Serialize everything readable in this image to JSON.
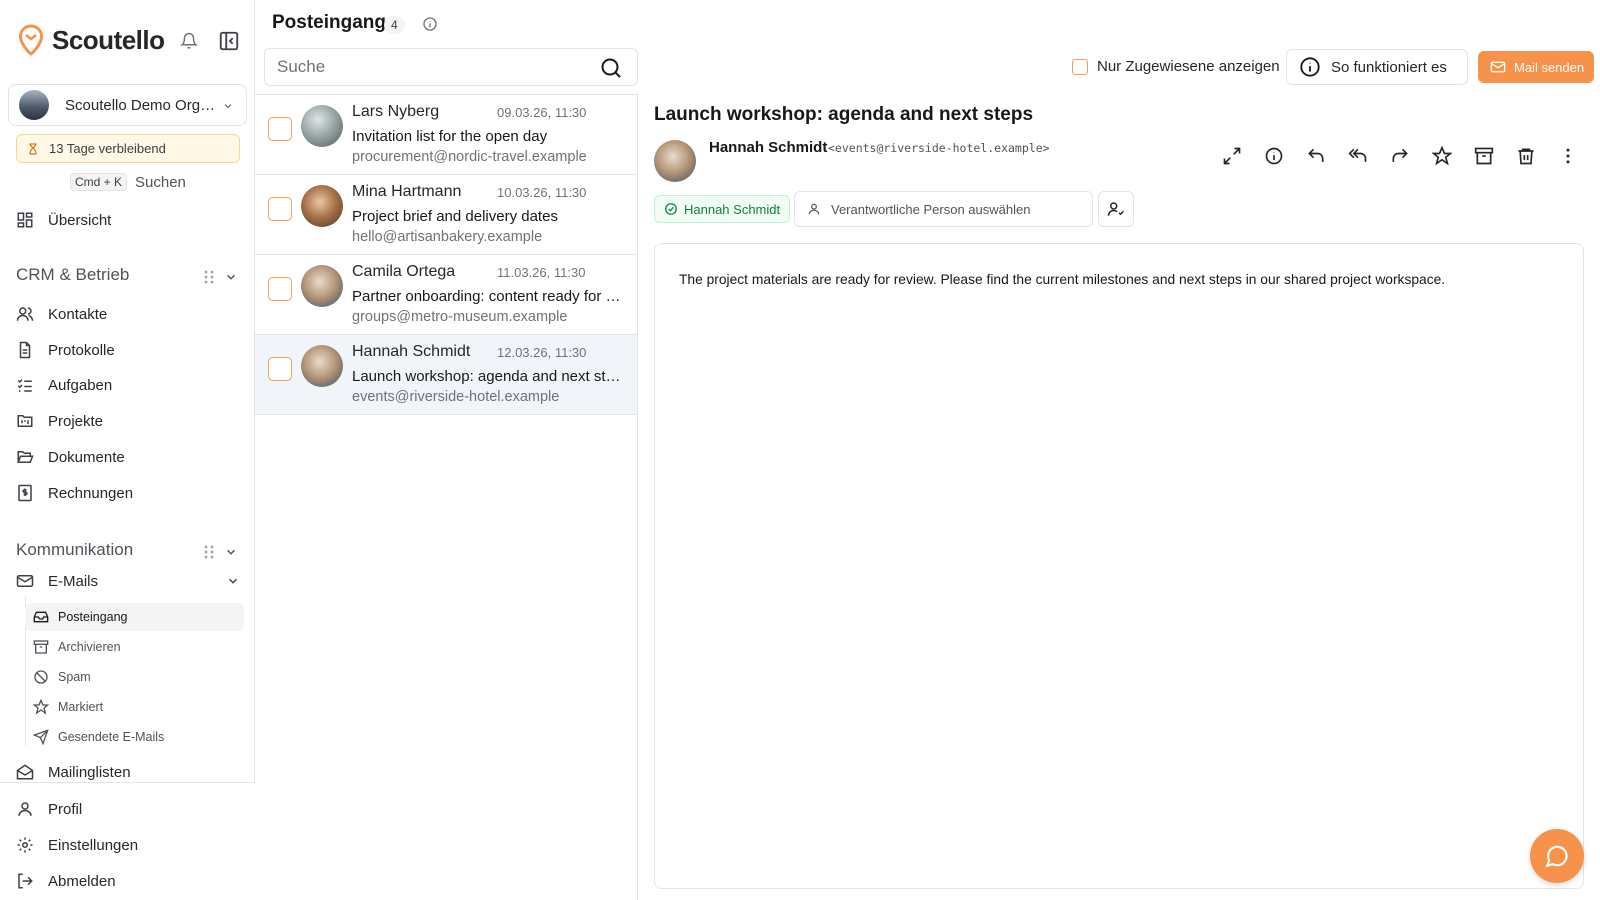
{
  "brand": {
    "name": "Scoutello"
  },
  "org": {
    "name": "Scoutello Demo Organisation"
  },
  "trial": {
    "text": "13 Tage verbleibend"
  },
  "search_shortcut": {
    "keys": "Cmd + K",
    "label": "Suchen"
  },
  "nav": {
    "overview": "Übersicht",
    "section_crm": "CRM & Betrieb",
    "crm_items": [
      "Kontakte",
      "Protokolle",
      "Aufgaben",
      "Projekte",
      "Dokumente",
      "Rechnungen"
    ],
    "section_comm": "Kommunikation",
    "emails": "E-Mails",
    "email_sub": [
      "Posteingang",
      "Archivieren",
      "Spam",
      "Markiert",
      "Gesendete E-Mails"
    ],
    "mailinglists": "Mailinglisten",
    "bottom": [
      "Profil",
      "Einstellungen",
      "Abmelden"
    ]
  },
  "inbox": {
    "title": "Posteingang",
    "count": "4",
    "search_placeholder": "Suche",
    "messages": [
      {
        "from": "Lars Nyberg",
        "date": "09.03.26, 11:30",
        "subject": "Invitation list for the open day",
        "address": "procurement@nordic-travel.example"
      },
      {
        "from": "Mina Hartmann",
        "date": "10.03.26, 11:30",
        "subject": "Project brief and delivery dates",
        "address": "hello@artisanbakery.example"
      },
      {
        "from": "Camila Ortega",
        "date": "11.03.26, 11:30",
        "subject": "Partner onboarding: content ready for review",
        "address": "groups@metro-museum.example"
      },
      {
        "from": "Hannah Schmidt",
        "date": "12.03.26, 11:30",
        "subject": "Launch workshop: agenda and next steps",
        "address": "events@riverside-hotel.example"
      }
    ]
  },
  "toolbar": {
    "assigned_only": "Nur Zugewiesene anzeigen",
    "howto": "So funktioniert es",
    "send": "Mail senden"
  },
  "detail": {
    "subject": "Launch workshop: agenda and next steps",
    "from_name": "Hannah Schmidt",
    "from_addr": "<events@riverside-hotel.example>",
    "tag": "Hannah Schmidt",
    "assign_placeholder": "Verantwortliche Person auswählen",
    "body": "The project materials are ready for review. Please find the current milestones and next steps in our shared project workspace."
  },
  "colors": {
    "accent": "#f7924a",
    "selected_row": "#f1f5f9",
    "tag_green": "#15803d"
  }
}
